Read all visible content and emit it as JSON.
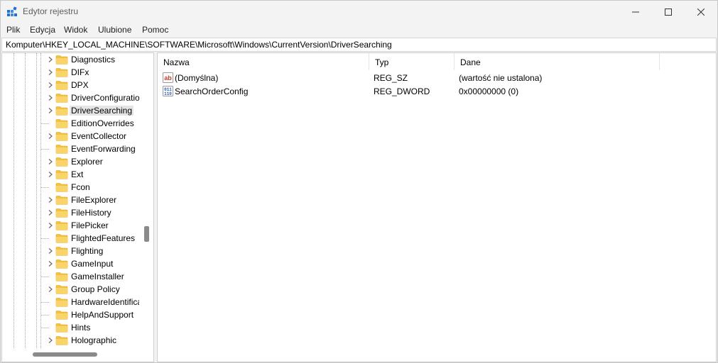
{
  "window": {
    "title": "Edytor rejestru",
    "icon": "regedit-icon",
    "controls": [
      "minimize-icon",
      "maximize-icon",
      "close-icon"
    ]
  },
  "menu": {
    "file": "Plik",
    "edit": "Edycja",
    "view": "Widok",
    "favorites": "Ulubione",
    "help": "Pomoc"
  },
  "address": {
    "path": "Komputer\\HKEY_LOCAL_MACHINE\\SOFTWARE\\Microsoft\\Windows\\CurrentVersion\\DriverSearching"
  },
  "tree": {
    "selected": "DriverSearching",
    "items": [
      {
        "label": "Diagnostics",
        "expandable": true
      },
      {
        "label": "DIFx",
        "expandable": true
      },
      {
        "label": "DPX",
        "expandable": true
      },
      {
        "label": "DriverConfiguratio",
        "expandable": true
      },
      {
        "label": "DriverSearching",
        "expandable": true
      },
      {
        "label": "EditionOverrides",
        "expandable": false
      },
      {
        "label": "EventCollector",
        "expandable": true
      },
      {
        "label": "EventForwarding",
        "expandable": false
      },
      {
        "label": "Explorer",
        "expandable": true
      },
      {
        "label": "Ext",
        "expandable": true
      },
      {
        "label": "Fcon",
        "expandable": false
      },
      {
        "label": "FileExplorer",
        "expandable": true
      },
      {
        "label": "FileHistory",
        "expandable": true
      },
      {
        "label": "FilePicker",
        "expandable": true
      },
      {
        "label": "FlightedFeatures",
        "expandable": false
      },
      {
        "label": "Flighting",
        "expandable": true
      },
      {
        "label": "GameInput",
        "expandable": true
      },
      {
        "label": "GameInstaller",
        "expandable": false
      },
      {
        "label": "Group Policy",
        "expandable": true
      },
      {
        "label": "HardwareIdentifica",
        "expandable": false
      },
      {
        "label": "HelpAndSupport",
        "expandable": false
      },
      {
        "label": "Hints",
        "expandable": false
      },
      {
        "label": "Holographic",
        "expandable": true
      }
    ]
  },
  "list": {
    "headers": {
      "name": "Nazwa",
      "type": "Typ",
      "data": "Dane"
    },
    "rows": [
      {
        "name": "(Domyślna)",
        "type": "REG_SZ",
        "data": "(wartość nie ustalona)",
        "icon": "string-value-icon"
      },
      {
        "name": "SearchOrderConfig",
        "type": "REG_DWORD",
        "data": "0x00000000 (0)",
        "icon": "binary-value-icon"
      }
    ]
  },
  "colors": {
    "folder": "#f3c33f",
    "selection": "#e5e5e5",
    "string_icon": "#c83a2b",
    "binary_icon": "#2a5cad"
  }
}
